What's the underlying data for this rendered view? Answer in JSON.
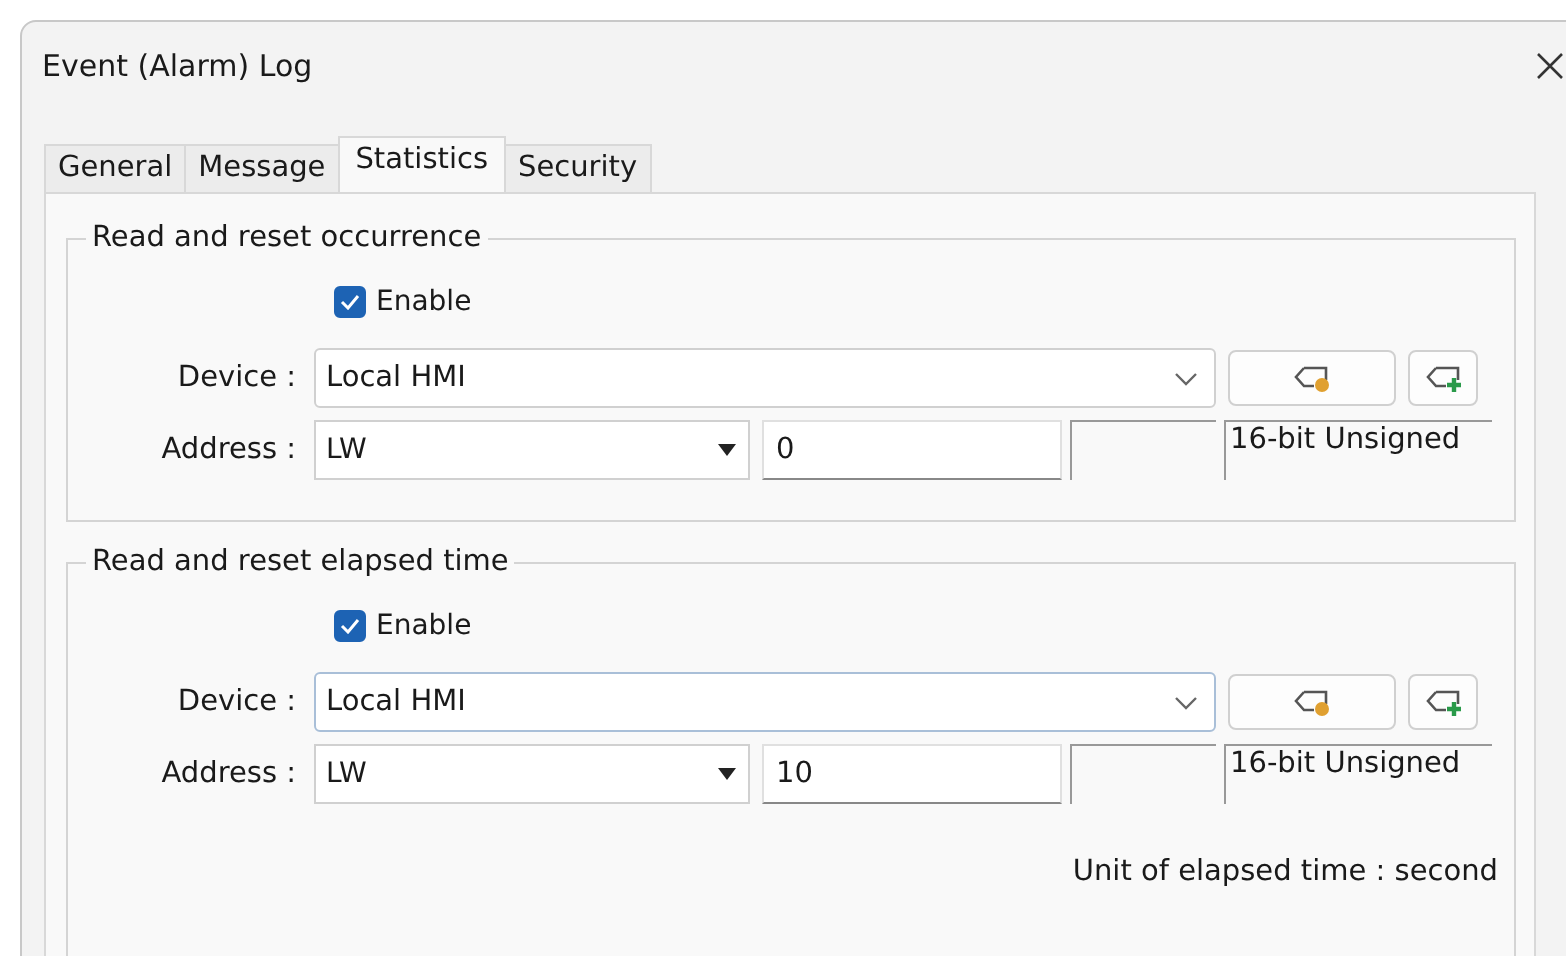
{
  "window": {
    "title": "Event (Alarm) Log"
  },
  "tabs": [
    {
      "label": "General",
      "selected": false
    },
    {
      "label": "Message",
      "selected": false
    },
    {
      "label": "Statistics",
      "selected": true
    },
    {
      "label": "Security",
      "selected": false
    }
  ],
  "groups": [
    {
      "title": "Read and reset occurrence",
      "enable": {
        "label": "Enable",
        "checked": true
      },
      "device": {
        "label": "Device :",
        "value": "Local HMI",
        "focused": false
      },
      "address": {
        "label": "Address :",
        "type": "LW",
        "value": "0",
        "data_type": "16-bit Unsigned"
      }
    },
    {
      "title": "Read and reset elapsed time",
      "enable": {
        "label": "Enable",
        "checked": true
      },
      "device": {
        "label": "Device :",
        "value": "Local HMI",
        "focused": true
      },
      "address": {
        "label": "Address :",
        "type": "LW",
        "value": "10",
        "data_type": "16-bit Unsigned"
      },
      "note": "Unit of elapsed time : second"
    }
  ]
}
